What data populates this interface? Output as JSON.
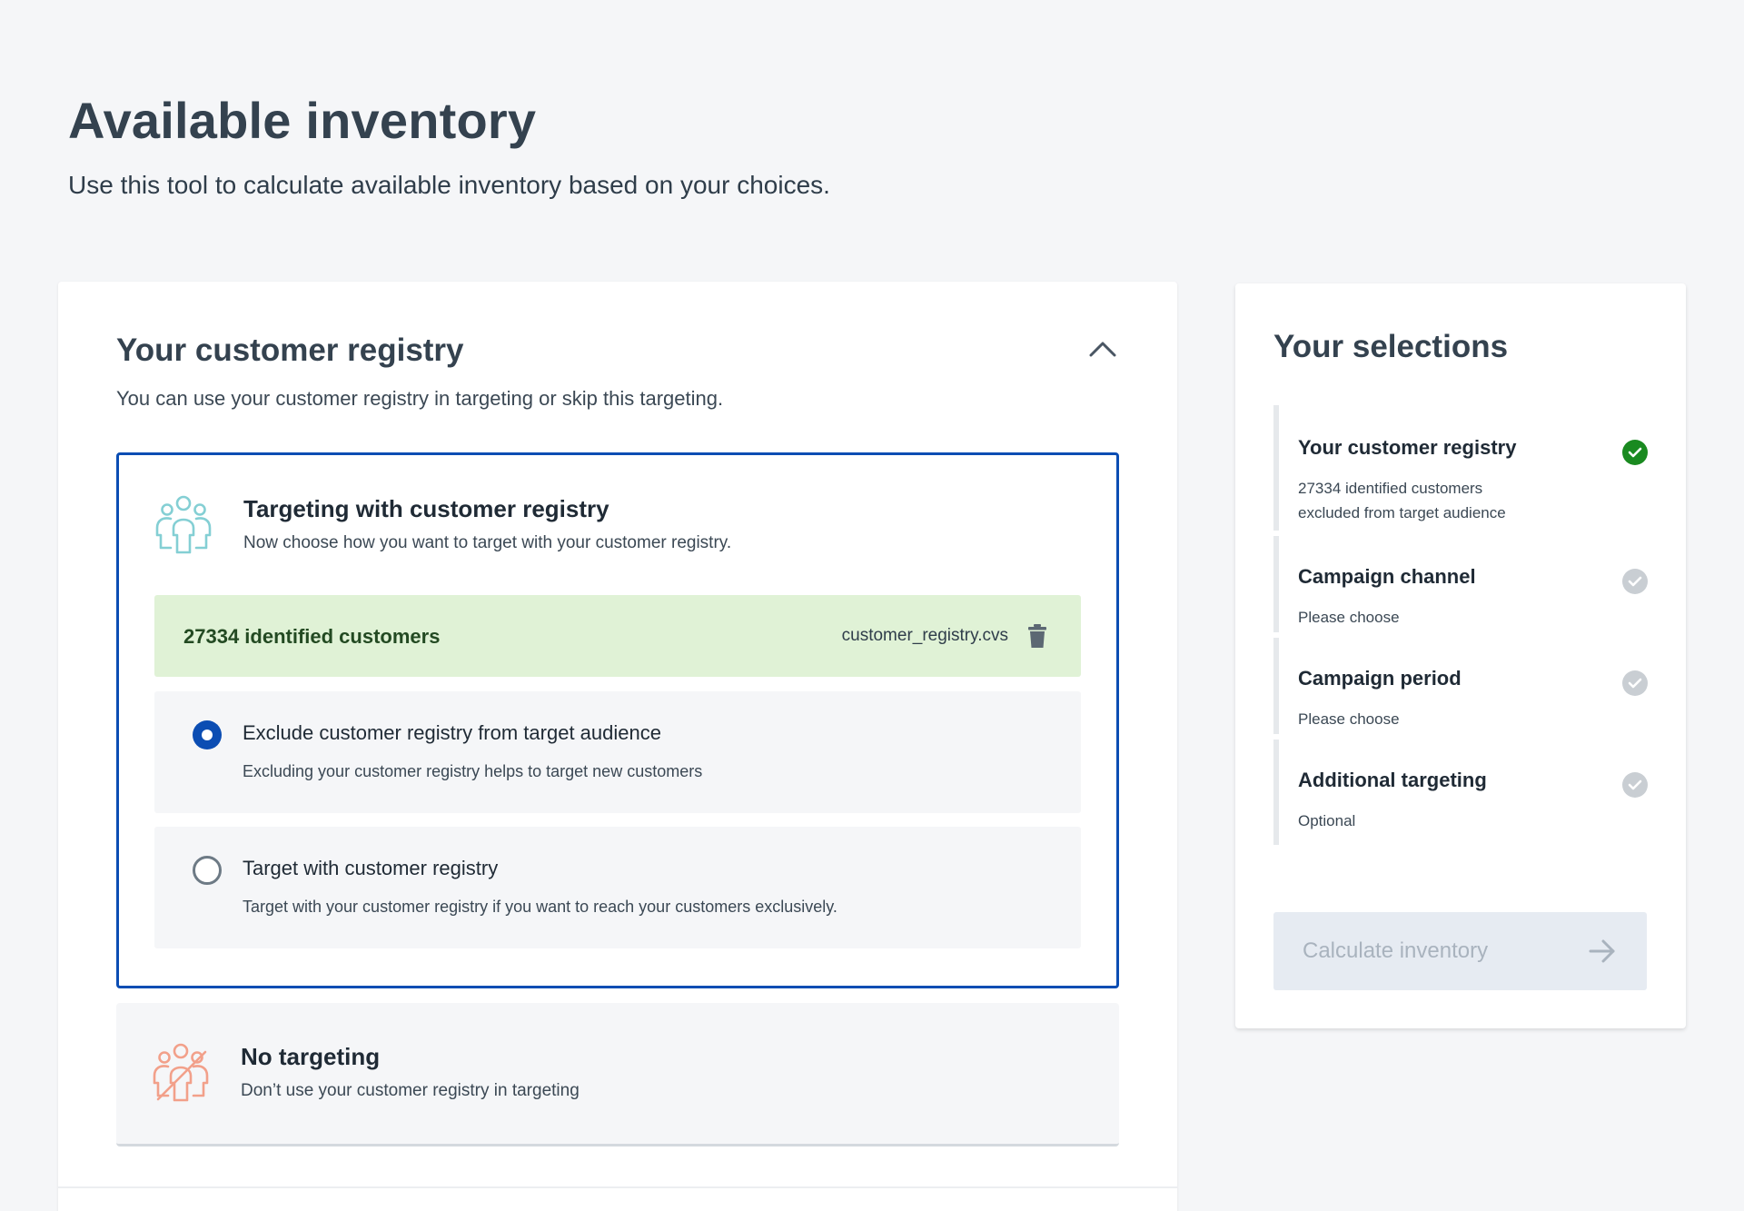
{
  "header": {
    "title": "Available inventory",
    "subtitle": "Use this tool to calculate available inventory based on your choices."
  },
  "registry_section": {
    "title": "Your customer registry",
    "description": "You can use your customer registry in targeting or skip this targeting.",
    "collapse_icon": "chevron-up-icon",
    "targeting_option": {
      "icon": "people-group-icon",
      "title": "Targeting with customer registry",
      "description": "Now choose how you want to target with your customer registry.",
      "registry": {
        "count_label": "27334 identified customers",
        "file_name": "customer_registry.cvs",
        "delete_icon": "trash-icon"
      },
      "radios": [
        {
          "label": "Exclude customer registry from target audience",
          "description": "Excluding your customer registry helps to target new customers",
          "selected": true
        },
        {
          "label": "Target with customer registry",
          "description": "Target with your customer registry if you want to reach your customers exclusively.",
          "selected": false
        }
      ]
    },
    "no_targeting_option": {
      "icon": "people-crossed-icon",
      "title": "No targeting",
      "description": "Don’t use your customer registry in targeting"
    }
  },
  "selections": {
    "title": "Your selections",
    "steps": [
      {
        "title": "Your customer registry",
        "line1": "27334 identified customers",
        "line2": "excluded from  target audience",
        "status": "done"
      },
      {
        "title": "Campaign channel",
        "line1": "Please choose",
        "status": "pending"
      },
      {
        "title": "Campaign period",
        "line1": "Please choose",
        "status": "pending"
      },
      {
        "title": "Additional targeting",
        "line1": "Optional",
        "status": "pending"
      }
    ],
    "calculate_button": {
      "label": "Calculate inventory",
      "icon": "arrow-right-icon",
      "disabled": true
    }
  },
  "colors": {
    "accent_blue": "#0b4db3",
    "success_green": "#1a8a20",
    "registry_bg": "#e0f2d6",
    "icon_teal": "#84cfd4",
    "icon_salmon": "#f2a08a"
  }
}
